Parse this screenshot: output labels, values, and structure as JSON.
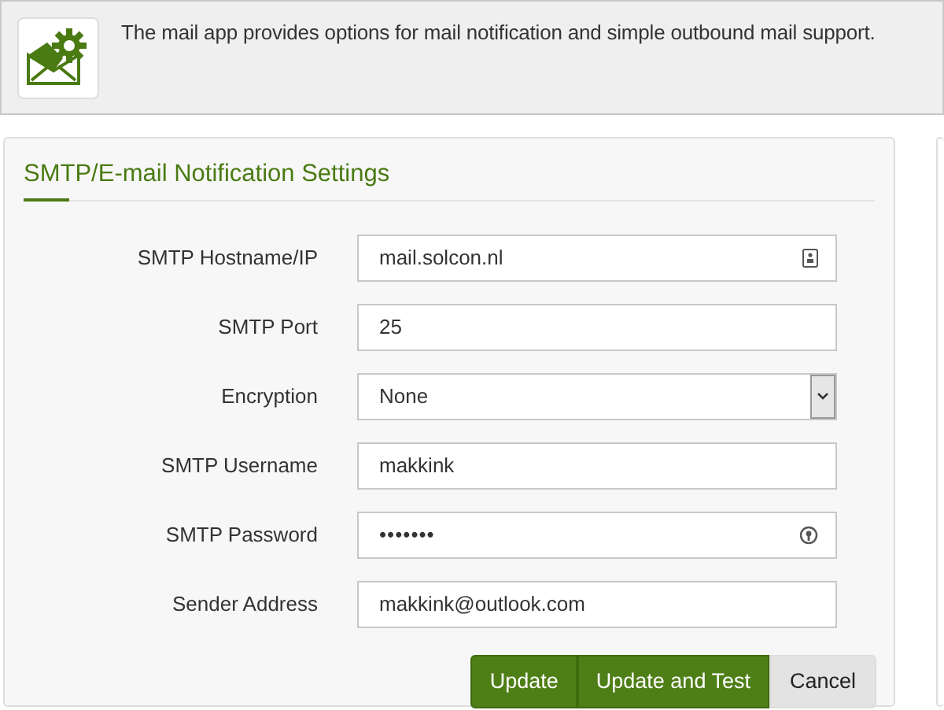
{
  "header": {
    "description": "The mail app provides options for mail notification and simple outbound mail support."
  },
  "panel": {
    "title": "SMTP/E-mail Notification Settings",
    "fields": [
      {
        "label": "SMTP Hostname/IP",
        "kind": "text",
        "value": "mail.solcon.nl",
        "card_icon": true
      },
      {
        "label": "SMTP Port",
        "kind": "text",
        "value": "25"
      },
      {
        "label": "Encryption",
        "kind": "select",
        "value": "None"
      },
      {
        "label": "SMTP Username",
        "kind": "text",
        "value": "makkink"
      },
      {
        "label": "SMTP Password",
        "kind": "password",
        "value": "•••••••",
        "key_icon": true
      },
      {
        "label": "Sender Address",
        "kind": "text",
        "value": "makkink@outlook.com"
      }
    ],
    "buttons": [
      {
        "label": "Update",
        "kind": "primary"
      },
      {
        "label": "Update and Test",
        "kind": "primary"
      },
      {
        "label": "Cancel",
        "kind": "secondary"
      }
    ]
  }
}
